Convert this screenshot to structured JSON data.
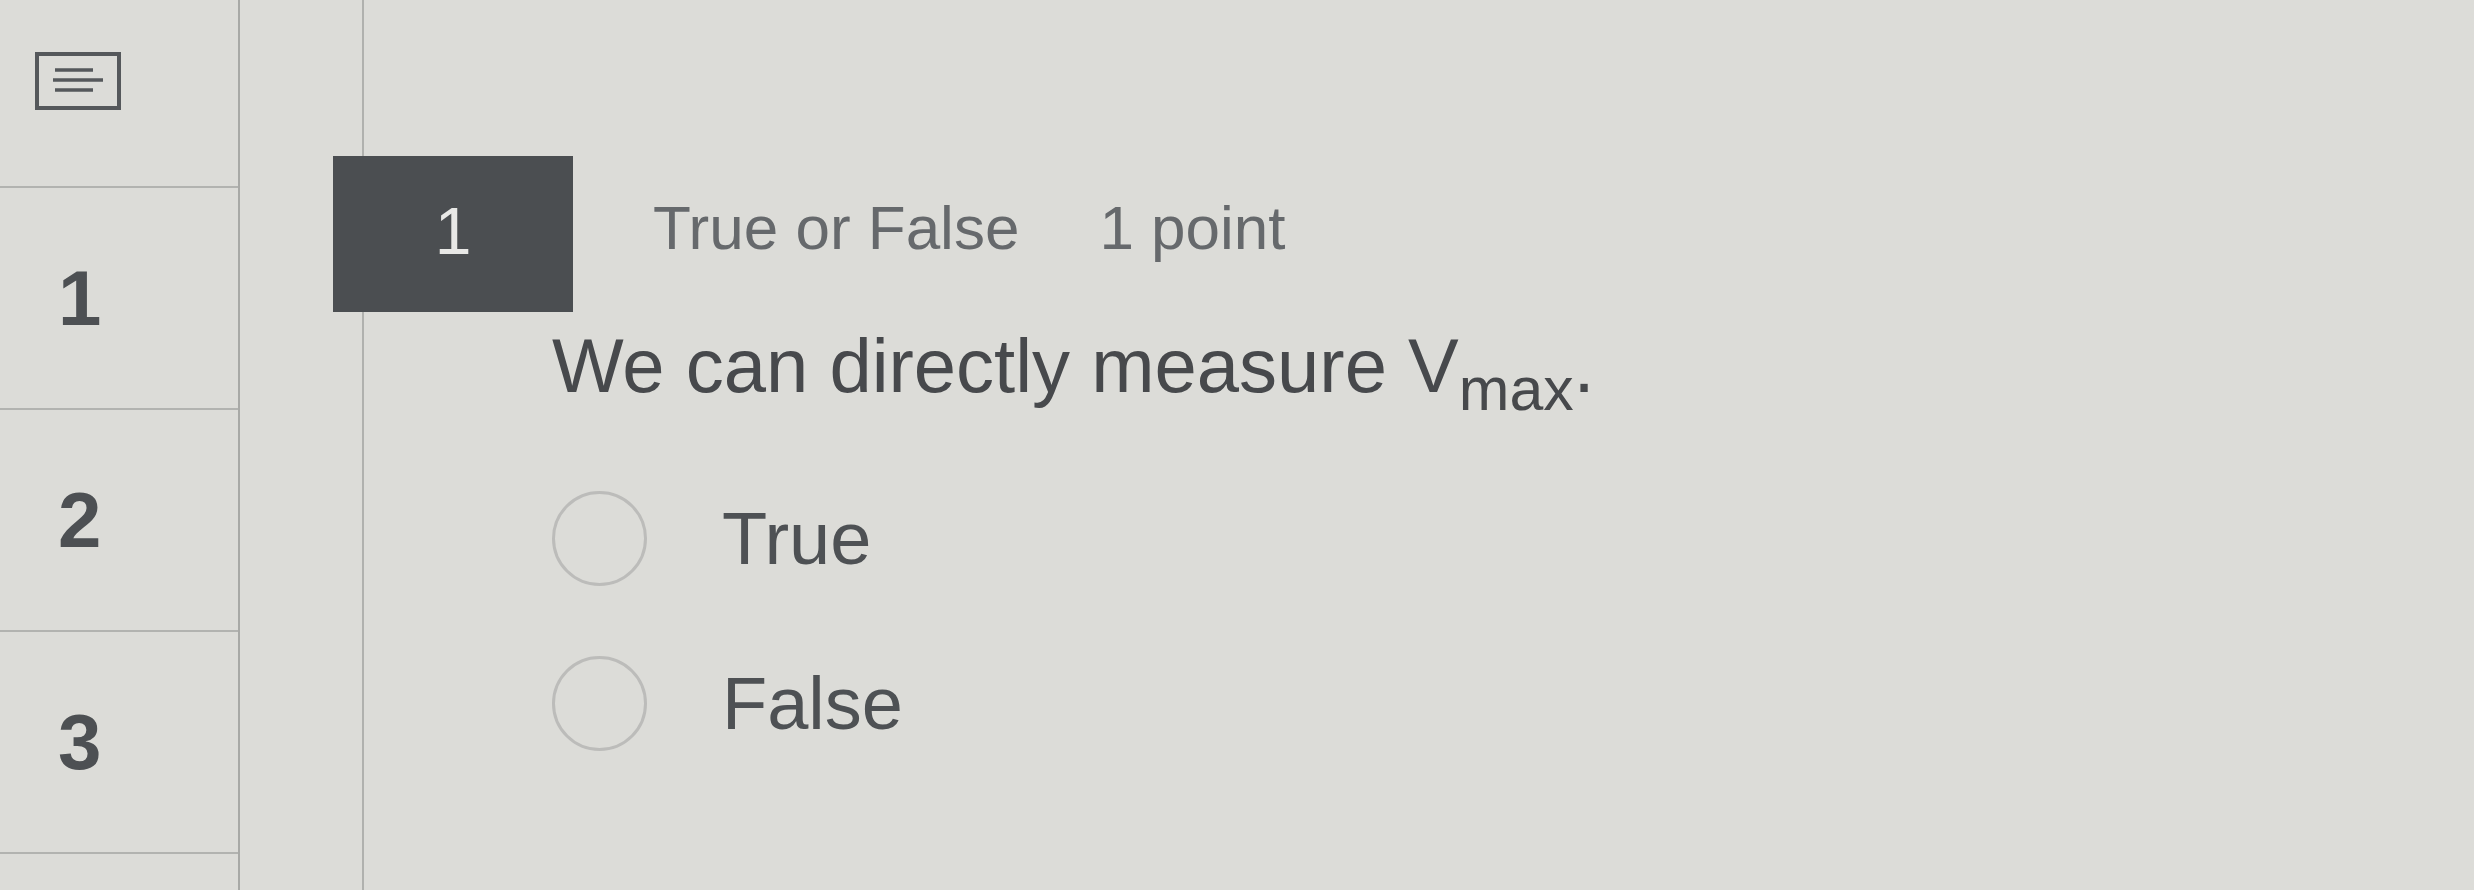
{
  "sidebar": {
    "items": [
      {
        "label": "1"
      },
      {
        "label": "2"
      },
      {
        "label": "3"
      }
    ]
  },
  "question": {
    "number": "1",
    "type": "True or False",
    "points": "1 point",
    "text": "We can directly measure V$_{max}$.",
    "options": [
      {
        "label": "True",
        "selected": false
      },
      {
        "label": "False",
        "selected": false
      }
    ]
  }
}
